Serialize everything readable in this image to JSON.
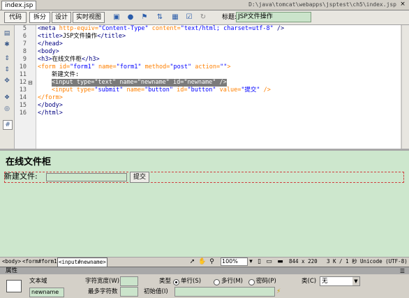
{
  "window": {
    "tab": "index.jsp",
    "path": "D:\\java\\tomcat\\webapps\\jsptest\\ch5\\index.jsp",
    "close": "×"
  },
  "toolbar": {
    "code": "代码",
    "split": "拆分",
    "design": "设计",
    "live": "实时视图",
    "title_label": "标题:",
    "title_value": "JSP文件操作"
  },
  "code_lines": [
    {
      "n": "5"
    },
    {
      "n": "6"
    },
    {
      "n": "7"
    },
    {
      "n": "8"
    },
    {
      "n": "9"
    },
    {
      "n": "10"
    },
    {
      "n": "11"
    },
    {
      "n": "12"
    },
    {
      "n": "13"
    },
    {
      "n": "14"
    },
    {
      "n": "15"
    },
    {
      "n": "16"
    }
  ],
  "code": {
    "l5a": "<meta ",
    "l5b": "http-equiv=",
    "l5c": "\"Content-Type\"",
    "l5d": " content=",
    "l5e": "\"text/html; charset=utf-8\"",
    "l5f": " />",
    "l6a": "<title>",
    "l6b": "JSP文件操作",
    "l6c": "</title>",
    "l7": "</head>",
    "l8": "<body>",
    "l9a": "<h3>",
    "l9b": "在线文件柜",
    "l9c": "</h3>",
    "l10a": "<form ",
    "l10b": "id=",
    "l10c": "\"form1\"",
    "l10d": " name=",
    "l10e": "\"form1\"",
    "l10f": " method=",
    "l10g": "\"post\"",
    "l10h": " action=",
    "l10i": "\"\"",
    "l10j": ">",
    "l11": "新建文件:",
    "l12": "<input type=\"text\" name=\"newname\" id=\"newname\" />",
    "l13a": "<input ",
    "l13b": "type=",
    "l13c": "\"submit\"",
    "l13d": " name=",
    "l13e": "\"button\"",
    "l13f": " id=",
    "l13g": "\"button\"",
    "l13h": " value=",
    "l13i": "\"提交\"",
    "l13j": " />",
    "l14": "</form>",
    "l15": "</body>",
    "l16": "</html>"
  },
  "design": {
    "heading": "在线文件柜",
    "label": "新建文件:",
    "button": "提交"
  },
  "status": {
    "crumb_body": "<body>",
    "crumb_form": "<form#form1>",
    "crumb_input": "<input#newname>",
    "zoom": "100%",
    "size": "844 x 220",
    "filesize": "3 K / 1 秒",
    "encoding": "Unicode (UTF-8)"
  },
  "properties": {
    "panel_title": "属性",
    "textfield_label": "文本域",
    "textfield_name": "newname",
    "char_width_label": "字符宽度(W)",
    "max_chars_label": "最多字符数",
    "type_label": "类型",
    "single_line": "单行(S)",
    "multi_line": "多行(M)",
    "password": "密码(P)",
    "init_value_label": "初始值(I)",
    "class_label": "类(C)",
    "class_value": "无"
  }
}
